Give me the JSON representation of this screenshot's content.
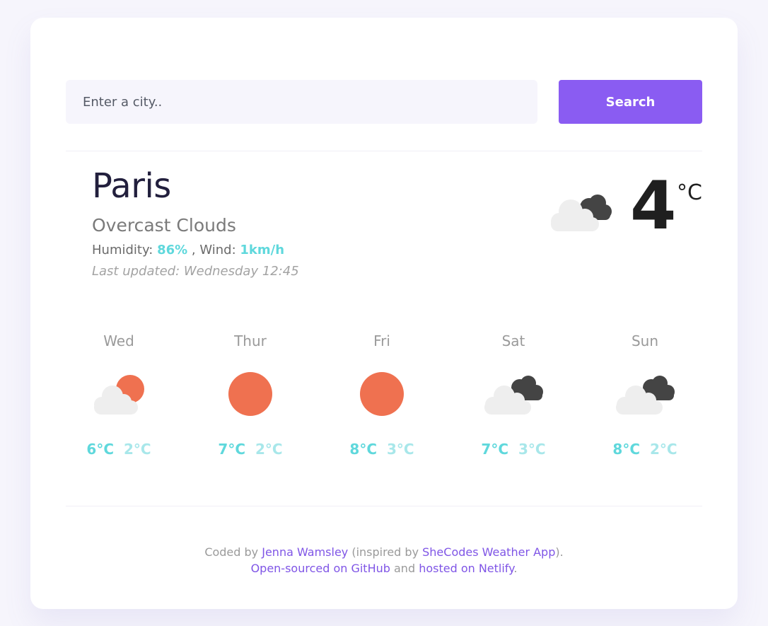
{
  "search": {
    "placeholder": "Enter a city..",
    "button_label": "Search"
  },
  "current": {
    "city": "Paris",
    "description": "Overcast Clouds",
    "humidity_label": "Humidity: ",
    "humidity_value": "86%",
    "wind_label": " , Wind: ",
    "wind_value": "1km/h",
    "last_updated": "Last updated: Wednesday 12:45",
    "temperature": "4",
    "unit": "°C",
    "icon": "overcast-clouds-icon"
  },
  "forecast": [
    {
      "day": "Wed",
      "icon": "partly-cloudy-sun-icon",
      "max": "6°C",
      "min": "2°C"
    },
    {
      "day": "Thur",
      "icon": "sun-icon",
      "max": "7°C",
      "min": "2°C"
    },
    {
      "day": "Fri",
      "icon": "sun-icon",
      "max": "8°C",
      "min": "3°C"
    },
    {
      "day": "Sat",
      "icon": "overcast-clouds-icon",
      "max": "7°C",
      "min": "3°C"
    },
    {
      "day": "Sun",
      "icon": "overcast-clouds-icon",
      "max": "8°C",
      "min": "2°C"
    }
  ],
  "footer": {
    "coded_by": "Coded by ",
    "author_link": "Jenna Wamsley",
    "inspired_prefix": " (inspired by ",
    "inspired_link": "SheCodes Weather App",
    "inspired_suffix": ").",
    "github_link": "Open-sourced on GitHub",
    "and_text": " and ",
    "netlify_link": "hosted on Netlify",
    "end_text": "."
  },
  "colors": {
    "accent": "#8a5cf2",
    "temp_high": "#5fd8dc",
    "temp_low": "#a8e7ea",
    "sun": "#ef7150",
    "dark_cloud": "#444444",
    "light_cloud": "#eeeeee"
  }
}
